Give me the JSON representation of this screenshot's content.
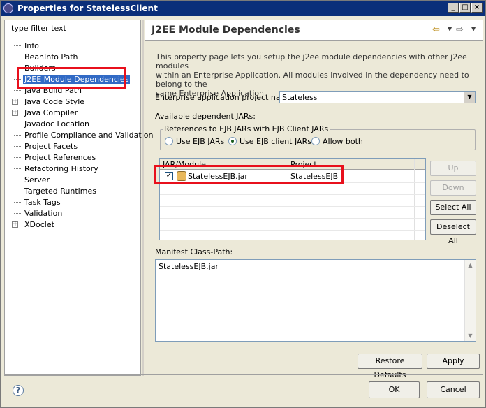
{
  "window": {
    "title": "Properties for StatelessClient"
  },
  "filter": {
    "value": "type filter text"
  },
  "tree": {
    "items": [
      {
        "label": "Info",
        "expandable": false
      },
      {
        "label": "BeanInfo Path",
        "expandable": false
      },
      {
        "label": "Builders",
        "expandable": false
      },
      {
        "label": "J2EE Module Dependencies",
        "expandable": false,
        "selected": true
      },
      {
        "label": "Java Build Path",
        "expandable": false
      },
      {
        "label": "Java Code Style",
        "expandable": true
      },
      {
        "label": "Java Compiler",
        "expandable": true
      },
      {
        "label": "Javadoc Location",
        "expandable": false
      },
      {
        "label": "Profile Compliance and Validation",
        "expandable": false
      },
      {
        "label": "Project Facets",
        "expandable": false
      },
      {
        "label": "Project References",
        "expandable": false
      },
      {
        "label": "Refactoring History",
        "expandable": false
      },
      {
        "label": "Server",
        "expandable": false
      },
      {
        "label": "Targeted Runtimes",
        "expandable": false
      },
      {
        "label": "Task Tags",
        "expandable": false
      },
      {
        "label": "Validation",
        "expandable": false
      },
      {
        "label": "XDoclet",
        "expandable": true
      }
    ]
  },
  "page": {
    "title": "J2EE Module Dependencies",
    "description_line1": "This property page lets you setup the j2ee module dependencies with other j2ee modules",
    "description_line2": "within an Enterprise Application.  All modules involved in the dependency need to belong to the",
    "description_line3": "same Enterprise Application.",
    "project_label": "Enterprise application project name:",
    "project_value": "Stateless",
    "available_label": "Available dependent JARs:",
    "group_title": "References to EJB JARs with EJB Client JARs",
    "radios": [
      {
        "label": "Use EJB JARs",
        "selected": false
      },
      {
        "label": "Use EJB client JARs",
        "selected": true
      },
      {
        "label": "Allow both",
        "selected": false
      }
    ],
    "table": {
      "columns": [
        "JAR/Module",
        "Project"
      ],
      "rows": [
        {
          "checked": true,
          "module": "StatelessEJB.jar",
          "project": "StatelessEJB"
        }
      ]
    },
    "buttons": {
      "up": "Up",
      "down": "Down",
      "select_all": "Select All",
      "deselect_all": "Deselect All"
    },
    "manifest_label": "Manifest Class-Path:",
    "manifest_value": "StatelessEJB.jar",
    "restore_defaults": "Restore Defaults",
    "apply": "Apply"
  },
  "footer": {
    "ok": "OK",
    "cancel": "Cancel",
    "help": "?"
  },
  "colors": {
    "highlight": "#e8101c",
    "selection": "#316ac5",
    "titlebar": "#0b2f7a"
  }
}
